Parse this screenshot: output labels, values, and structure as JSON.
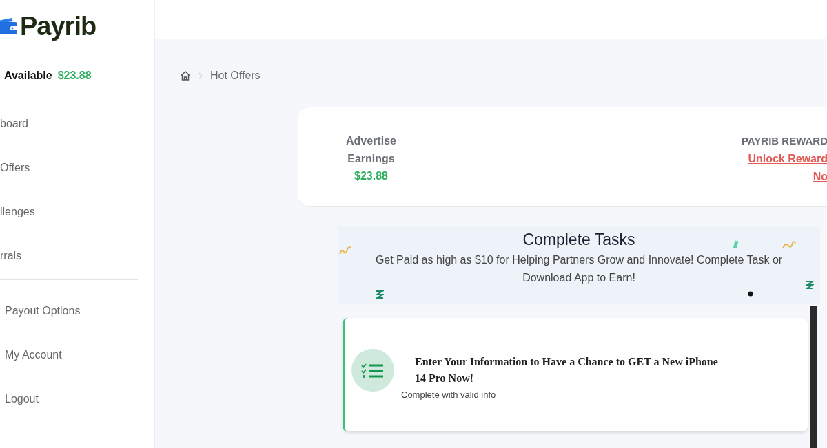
{
  "logo": {
    "text": "Payrib"
  },
  "balance": {
    "label": "Available",
    "amount": "$23.88"
  },
  "nav_items": [
    {
      "label": "board"
    },
    {
      "label": "Offers"
    },
    {
      "label": "llenges"
    },
    {
      "label": "rrals"
    }
  ],
  "account_items": [
    {
      "label": "Payout Options"
    },
    {
      "label": "My Account"
    },
    {
      "label": "Logout"
    }
  ],
  "breadcrumb": {
    "current": "Hot Offers"
  },
  "earnings_card": {
    "label_lines": [
      "Advertise",
      "Earnings"
    ],
    "amount": "$23.88",
    "rewards_title": "PAYRIB REWARD",
    "rewards_link_lines": [
      "Unlock Reward",
      "No"
    ]
  },
  "banner": {
    "title": "Complete Tasks",
    "text": "Get Paid as high as $10 for Helping Partners Grow and Innovate! Complete Task or Download App to Earn!"
  },
  "tasks": [
    {
      "title": "Enter Your Information to Have a Chance to GET a New iPhone 14 Pro Now!",
      "subtitle": "Complete with valid info"
    }
  ]
}
